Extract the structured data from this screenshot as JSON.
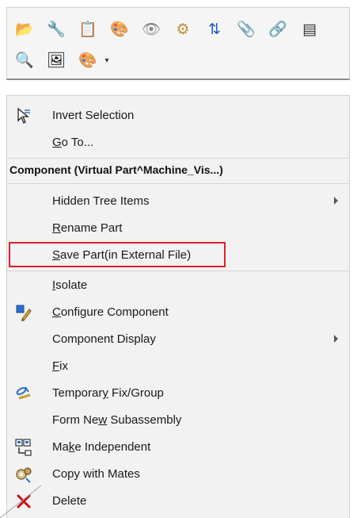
{
  "toolbar": {
    "row1": [
      {
        "icon": "open-part-icon",
        "glyph": "📂"
      },
      {
        "icon": "edit-component-icon",
        "glyph": "🔧"
      },
      {
        "icon": "open-drawing-icon",
        "glyph": "📋"
      },
      {
        "icon": "appearance-icon",
        "glyph": "🎨"
      },
      {
        "icon": "hide-component-icon",
        "glyph": "👁"
      },
      {
        "icon": "show-with-dependents-icon",
        "glyph": "⚙"
      },
      {
        "icon": "reorder-icon",
        "glyph": "⇅"
      },
      {
        "icon": "mate-icon",
        "glyph": "📎"
      },
      {
        "icon": "view-mates-icon",
        "glyph": "🔗"
      },
      {
        "icon": "properties-icon",
        "glyph": "▤"
      }
    ],
    "row2": [
      {
        "icon": "zoom-to-selection-icon",
        "glyph": "🔍"
      },
      {
        "icon": "component-preview-icon",
        "glyph": "🖼"
      },
      {
        "icon": "appearance-palette-icon",
        "glyph": "🎨"
      }
    ],
    "dropdown_glyph": "▾"
  },
  "menu": {
    "invert_selection": "Invert Selection",
    "go_to": {
      "mnemonic": "G",
      "rest": "o To..."
    },
    "section_header": "Component (Virtual Part^Machine_Vis...)",
    "hidden_tree_items": "Hidden Tree Items",
    "rename_part": {
      "mnemonic": "R",
      "rest": "ename Part"
    },
    "save_part": {
      "mnemonic": "S",
      "rest": "ave Part(in External File)"
    },
    "isolate": {
      "mnemonic": "I",
      "rest": "solate"
    },
    "configure_component": {
      "mnemonic": "C",
      "rest": "onfigure Component"
    },
    "component_display": "Component Display",
    "fix": {
      "mnemonic": "F",
      "rest": "ix"
    },
    "temporary_fix": {
      "before": "Temporar",
      "mnemonic": "y",
      "rest": " Fix/Group"
    },
    "form_new_subassembly": {
      "before": "Form Ne",
      "mnemonic": "w",
      "rest": " Subassembly"
    },
    "make_independent": {
      "before": "Ma",
      "mnemonic": "k",
      "rest": "e Independent"
    },
    "copy_with_mates": "Copy with Mates",
    "delete": "Delete"
  },
  "colors": {
    "highlight_border": "#e0202a",
    "delete_icon": "#d01010",
    "menu_bg": "#f2f2f2"
  }
}
